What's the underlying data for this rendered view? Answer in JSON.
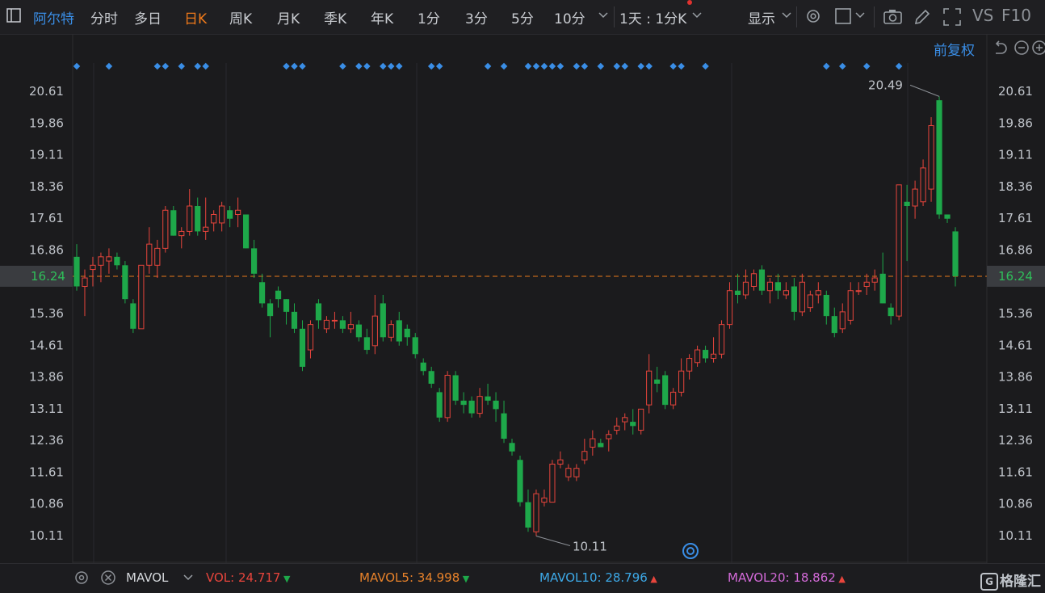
{
  "toolbar": {
    "stock_name": "阿尔特",
    "periods": [
      "分时",
      "多日",
      "日K",
      "周K",
      "月K",
      "季K",
      "年K",
      "1分",
      "3分",
      "5分",
      "10分"
    ],
    "active_period": "日K",
    "interval_select": "1天 : 1分K",
    "display_label": "显示",
    "vs_label": "VS",
    "f10_label": "F10"
  },
  "chart_header": {
    "adjust_label": "前复权"
  },
  "chart_data": {
    "type": "candlestick",
    "y_axis_labels": [
      "20.61",
      "19.86",
      "19.11",
      "18.36",
      "17.61",
      "16.86",
      "16.24",
      "15.36",
      "14.61",
      "13.86",
      "13.11",
      "12.36",
      "11.61",
      "10.86",
      "10.11"
    ],
    "ylim": [
      9.46,
      21.28
    ],
    "current_price": "16.24",
    "high_label": "20.49",
    "low_label": "10.11",
    "up_color": "#e8453c",
    "down_color": "#1ea84a",
    "price_line_color": "#e87a1c",
    "candles": [
      {
        "o": 16.7,
        "h": 17.0,
        "l": 15.9,
        "c": 16.0
      },
      {
        "o": 16.0,
        "h": 16.4,
        "l": 15.3,
        "c": 16.2
      },
      {
        "o": 16.4,
        "h": 16.7,
        "l": 16.0,
        "c": 16.5
      },
      {
        "o": 16.5,
        "h": 16.8,
        "l": 16.1,
        "c": 16.7
      },
      {
        "o": 16.6,
        "h": 16.9,
        "l": 16.3,
        "c": 16.7
      },
      {
        "o": 16.7,
        "h": 16.8,
        "l": 16.4,
        "c": 16.5
      },
      {
        "o": 16.5,
        "h": 16.6,
        "l": 15.6,
        "c": 15.7
      },
      {
        "o": 15.6,
        "h": 15.7,
        "l": 14.9,
        "c": 15.0
      },
      {
        "o": 15.0,
        "h": 16.5,
        "l": 15.0,
        "c": 16.5
      },
      {
        "o": 16.5,
        "h": 17.4,
        "l": 16.3,
        "c": 17.0
      },
      {
        "o": 16.5,
        "h": 17.1,
        "l": 16.2,
        "c": 16.9
      },
      {
        "o": 16.9,
        "h": 17.9,
        "l": 16.8,
        "c": 17.8
      },
      {
        "o": 17.8,
        "h": 17.9,
        "l": 17.2,
        "c": 17.2
      },
      {
        "o": 17.2,
        "h": 17.4,
        "l": 16.9,
        "c": 17.3
      },
      {
        "o": 17.3,
        "h": 18.3,
        "l": 17.2,
        "c": 17.9
      },
      {
        "o": 17.9,
        "h": 18.1,
        "l": 17.2,
        "c": 17.3
      },
      {
        "o": 17.3,
        "h": 18.1,
        "l": 17.1,
        "c": 17.4
      },
      {
        "o": 17.5,
        "h": 17.8,
        "l": 17.3,
        "c": 17.7
      },
      {
        "o": 17.5,
        "h": 18.0,
        "l": 17.3,
        "c": 17.9
      },
      {
        "o": 17.8,
        "h": 17.9,
        "l": 17.4,
        "c": 17.6
      },
      {
        "o": 17.7,
        "h": 18.1,
        "l": 17.4,
        "c": 17.8
      },
      {
        "o": 17.7,
        "h": 17.7,
        "l": 16.9,
        "c": 16.9
      },
      {
        "o": 16.9,
        "h": 17.1,
        "l": 16.2,
        "c": 16.3
      },
      {
        "o": 16.1,
        "h": 16.3,
        "l": 15.5,
        "c": 15.6
      },
      {
        "o": 15.6,
        "h": 15.7,
        "l": 14.8,
        "c": 15.3
      },
      {
        "o": 15.9,
        "h": 16.0,
        "l": 15.5,
        "c": 15.7
      },
      {
        "o": 15.7,
        "h": 15.7,
        "l": 15.1,
        "c": 15.4
      },
      {
        "o": 15.4,
        "h": 15.6,
        "l": 14.9,
        "c": 15.0
      },
      {
        "o": 15.0,
        "h": 15.2,
        "l": 14.0,
        "c": 14.1
      },
      {
        "o": 14.5,
        "h": 15.2,
        "l": 14.3,
        "c": 15.1
      },
      {
        "o": 15.6,
        "h": 15.7,
        "l": 15.0,
        "c": 15.2
      },
      {
        "o": 15.0,
        "h": 15.3,
        "l": 14.9,
        "c": 15.2
      },
      {
        "o": 15.2,
        "h": 15.4,
        "l": 15.0,
        "c": 15.2
      },
      {
        "o": 15.2,
        "h": 15.3,
        "l": 14.9,
        "c": 15.0
      },
      {
        "o": 15.0,
        "h": 15.4,
        "l": 14.9,
        "c": 15.1
      },
      {
        "o": 15.1,
        "h": 15.2,
        "l": 14.7,
        "c": 14.8
      },
      {
        "o": 14.8,
        "h": 15.0,
        "l": 14.4,
        "c": 14.5
      },
      {
        "o": 14.6,
        "h": 15.8,
        "l": 14.4,
        "c": 15.3
      },
      {
        "o": 15.6,
        "h": 15.8,
        "l": 14.7,
        "c": 14.8
      },
      {
        "o": 14.8,
        "h": 15.2,
        "l": 14.7,
        "c": 15.1
      },
      {
        "o": 15.2,
        "h": 15.4,
        "l": 14.6,
        "c": 14.7
      },
      {
        "o": 15.0,
        "h": 15.1,
        "l": 14.6,
        "c": 14.8
      },
      {
        "o": 14.8,
        "h": 14.9,
        "l": 14.3,
        "c": 14.4
      },
      {
        "o": 14.2,
        "h": 14.3,
        "l": 13.9,
        "c": 14.0
      },
      {
        "o": 14.0,
        "h": 14.1,
        "l": 13.6,
        "c": 13.7
      },
      {
        "o": 13.5,
        "h": 13.6,
        "l": 12.8,
        "c": 12.9
      },
      {
        "o": 12.9,
        "h": 14.0,
        "l": 12.8,
        "c": 13.9
      },
      {
        "o": 13.9,
        "h": 14.0,
        "l": 13.2,
        "c": 13.3
      },
      {
        "o": 13.3,
        "h": 13.5,
        "l": 13.0,
        "c": 13.2
      },
      {
        "o": 13.3,
        "h": 13.4,
        "l": 12.9,
        "c": 13.0
      },
      {
        "o": 13.0,
        "h": 13.6,
        "l": 12.9,
        "c": 13.4
      },
      {
        "o": 13.4,
        "h": 13.7,
        "l": 13.2,
        "c": 13.3
      },
      {
        "o": 13.3,
        "h": 13.5,
        "l": 12.8,
        "c": 13.1
      },
      {
        "o": 13.0,
        "h": 13.3,
        "l": 12.3,
        "c": 12.4
      },
      {
        "o": 12.3,
        "h": 12.4,
        "l": 12.0,
        "c": 12.1
      },
      {
        "o": 11.9,
        "h": 12.0,
        "l": 10.8,
        "c": 10.9
      },
      {
        "o": 10.9,
        "h": 11.2,
        "l": 10.2,
        "c": 10.3
      },
      {
        "o": 10.2,
        "h": 11.2,
        "l": 10.1,
        "c": 11.1
      },
      {
        "o": 10.9,
        "h": 11.2,
        "l": 10.8,
        "c": 11.0
      },
      {
        "o": 10.9,
        "h": 11.9,
        "l": 10.9,
        "c": 11.8
      },
      {
        "o": 11.8,
        "h": 12.1,
        "l": 11.7,
        "c": 11.9
      },
      {
        "o": 11.5,
        "h": 11.8,
        "l": 11.4,
        "c": 11.7
      },
      {
        "o": 11.5,
        "h": 11.8,
        "l": 11.4,
        "c": 11.7
      },
      {
        "o": 11.9,
        "h": 12.4,
        "l": 11.8,
        "c": 12.1
      },
      {
        "o": 12.2,
        "h": 12.6,
        "l": 12.0,
        "c": 12.4
      },
      {
        "o": 12.3,
        "h": 12.4,
        "l": 12.2,
        "c": 12.2
      },
      {
        "o": 12.4,
        "h": 12.6,
        "l": 12.1,
        "c": 12.5
      },
      {
        "o": 12.6,
        "h": 12.9,
        "l": 12.5,
        "c": 12.7
      },
      {
        "o": 12.8,
        "h": 13.0,
        "l": 12.6,
        "c": 12.9
      },
      {
        "o": 12.8,
        "h": 13.1,
        "l": 12.5,
        "c": 12.7
      },
      {
        "o": 12.6,
        "h": 13.1,
        "l": 12.5,
        "c": 13.1
      },
      {
        "o": 13.2,
        "h": 14.4,
        "l": 13.0,
        "c": 14.0
      },
      {
        "o": 13.8,
        "h": 14.1,
        "l": 13.5,
        "c": 13.7
      },
      {
        "o": 13.9,
        "h": 14.0,
        "l": 13.1,
        "c": 13.2
      },
      {
        "o": 13.2,
        "h": 13.6,
        "l": 13.1,
        "c": 13.5
      },
      {
        "o": 13.5,
        "h": 14.3,
        "l": 13.4,
        "c": 14.0
      },
      {
        "o": 14.0,
        "h": 14.4,
        "l": 13.8,
        "c": 14.3
      },
      {
        "o": 14.2,
        "h": 14.6,
        "l": 14.1,
        "c": 14.5
      },
      {
        "o": 14.5,
        "h": 14.6,
        "l": 14.2,
        "c": 14.3
      },
      {
        "o": 14.3,
        "h": 14.8,
        "l": 14.2,
        "c": 14.4
      },
      {
        "o": 14.4,
        "h": 15.2,
        "l": 14.3,
        "c": 15.1
      },
      {
        "o": 15.1,
        "h": 16.1,
        "l": 15.0,
        "c": 15.9
      },
      {
        "o": 15.9,
        "h": 16.3,
        "l": 15.6,
        "c": 15.8
      },
      {
        "o": 15.8,
        "h": 16.4,
        "l": 15.7,
        "c": 16.1
      },
      {
        "o": 16.0,
        "h": 16.4,
        "l": 15.9,
        "c": 16.3
      },
      {
        "o": 16.4,
        "h": 16.5,
        "l": 15.8,
        "c": 15.9
      },
      {
        "o": 15.9,
        "h": 16.2,
        "l": 15.6,
        "c": 16.1
      },
      {
        "o": 16.1,
        "h": 16.3,
        "l": 15.7,
        "c": 15.9
      },
      {
        "o": 15.8,
        "h": 16.1,
        "l": 15.7,
        "c": 15.9
      },
      {
        "o": 16.0,
        "h": 16.2,
        "l": 15.2,
        "c": 15.4
      },
      {
        "o": 15.4,
        "h": 16.3,
        "l": 15.3,
        "c": 16.1
      },
      {
        "o": 15.5,
        "h": 15.9,
        "l": 15.4,
        "c": 15.8
      },
      {
        "o": 15.8,
        "h": 16.1,
        "l": 15.6,
        "c": 15.9
      },
      {
        "o": 15.8,
        "h": 15.9,
        "l": 15.1,
        "c": 15.3
      },
      {
        "o": 15.3,
        "h": 15.5,
        "l": 14.8,
        "c": 14.9
      },
      {
        "o": 15.0,
        "h": 15.6,
        "l": 14.9,
        "c": 15.4
      },
      {
        "o": 15.2,
        "h": 16.1,
        "l": 15.1,
        "c": 15.9
      },
      {
        "o": 15.9,
        "h": 16.1,
        "l": 15.8,
        "c": 15.9
      },
      {
        "o": 16.0,
        "h": 16.3,
        "l": 15.8,
        "c": 16.1
      },
      {
        "o": 16.1,
        "h": 16.4,
        "l": 15.9,
        "c": 16.2
      },
      {
        "o": 16.3,
        "h": 16.8,
        "l": 15.6,
        "c": 15.6
      },
      {
        "o": 15.5,
        "h": 15.6,
        "l": 15.1,
        "c": 15.3
      },
      {
        "o": 15.3,
        "h": 18.4,
        "l": 15.2,
        "c": 18.4
      },
      {
        "o": 18.0,
        "h": 18.4,
        "l": 16.6,
        "c": 17.9
      },
      {
        "o": 17.9,
        "h": 18.5,
        "l": 17.6,
        "c": 18.3
      },
      {
        "o": 18.0,
        "h": 19.0,
        "l": 17.9,
        "c": 18.8
      },
      {
        "o": 18.3,
        "h": 20.0,
        "l": 18.0,
        "c": 19.8
      },
      {
        "o": 20.4,
        "h": 20.49,
        "l": 17.6,
        "c": 17.7
      },
      {
        "o": 17.7,
        "h": 17.7,
        "l": 17.5,
        "c": 17.6
      },
      {
        "o": 17.3,
        "h": 17.4,
        "l": 16.0,
        "c": 16.24
      }
    ],
    "dot_marker_candles": [
      0,
      4,
      10,
      11,
      13,
      15,
      16,
      26,
      27,
      28,
      33,
      35,
      36,
      38,
      39,
      40,
      44,
      45,
      51,
      53,
      56,
      57,
      58,
      59,
      60,
      62,
      63,
      65,
      67,
      68,
      70,
      71,
      74,
      75,
      78,
      93,
      95,
      98,
      102
    ]
  },
  "volume_bar": {
    "indicator": "MAVOL",
    "items": [
      {
        "label": "VOL:",
        "value": "24.717",
        "arrow": "down",
        "color": "#e8453c"
      },
      {
        "label": "MAVOL5:",
        "value": "34.998",
        "arrow": "down",
        "color": "#e8822a"
      },
      {
        "label": "MAVOL10:",
        "value": "28.796",
        "arrow": "up",
        "color": "#3da9e8"
      },
      {
        "label": "MAVOL20:",
        "value": "18.862",
        "arrow": "up",
        "color": "#d46ad9"
      }
    ]
  },
  "brand": {
    "name": "格隆汇"
  }
}
